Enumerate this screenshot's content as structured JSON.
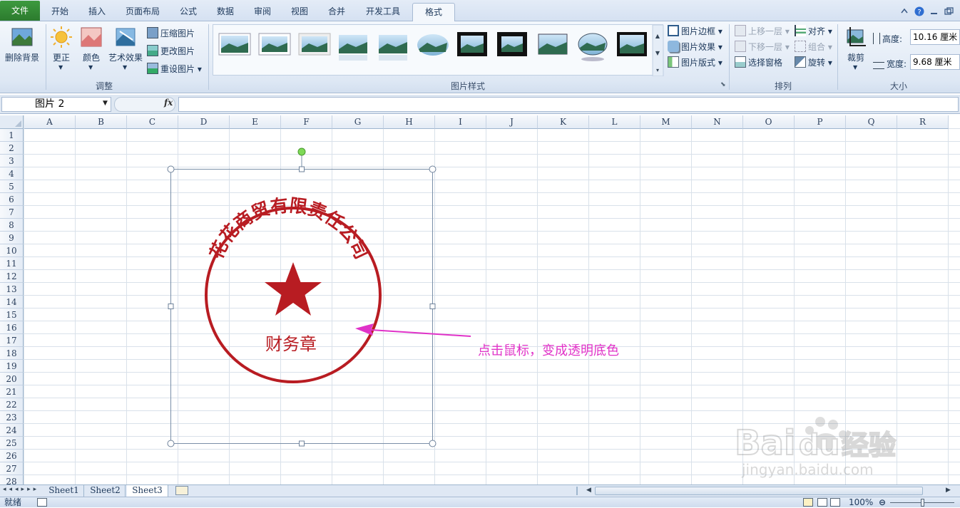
{
  "tabs": [
    {
      "label": "文件"
    },
    {
      "label": "开始"
    },
    {
      "label": "插入"
    },
    {
      "label": "页面布局"
    },
    {
      "label": "公式"
    },
    {
      "label": "数据"
    },
    {
      "label": "审阅"
    },
    {
      "label": "视图"
    },
    {
      "label": "合并"
    },
    {
      "label": "开发工具"
    },
    {
      "label": "格式"
    }
  ],
  "ribbon": {
    "adjust": {
      "remove_bg": "删除背景",
      "corrections": "更正",
      "color": "颜色",
      "artistic": "艺术效果",
      "compress": "压缩图片",
      "change": "更改图片",
      "reset": "重设图片",
      "group_label": "调整"
    },
    "styles": {
      "border": "图片边框",
      "effects": "图片效果",
      "layout": "图片版式",
      "group_label": "图片样式"
    },
    "arrange": {
      "bring_forward": "上移一层",
      "send_backward": "下移一层",
      "selection_pane": "选择窗格",
      "align": "对齐",
      "group": "组合",
      "rotate": "旋转",
      "group_label": "排列"
    },
    "size": {
      "crop": "裁剪",
      "height_label": "高度:",
      "height_value": "10.16 厘米",
      "width_label": "宽度:",
      "width_value": "9.68 厘米",
      "group_label": "大小"
    }
  },
  "formula_bar": {
    "name_box": "图片 2",
    "fx": "fx"
  },
  "columns": [
    "A",
    "B",
    "C",
    "D",
    "E",
    "F",
    "G",
    "H",
    "I",
    "J",
    "K",
    "L",
    "M",
    "N",
    "O",
    "P",
    "Q",
    "R"
  ],
  "rows": [
    "1",
    "2",
    "3",
    "4",
    "5",
    "6",
    "7",
    "8",
    "9",
    "10",
    "11",
    "12",
    "13",
    "14",
    "15",
    "16",
    "17",
    "18",
    "19",
    "20",
    "21",
    "22",
    "23",
    "24",
    "25",
    "26",
    "27",
    "28"
  ],
  "stamp": {
    "company": "花花商贸有限责任公司",
    "label": "财务章",
    "color": "#b81c22"
  },
  "annotation": {
    "text": "点击鼠标，变成透明底色",
    "color": "#e032c8"
  },
  "sheets": [
    "Sheet1",
    "Sheet2",
    "Sheet3"
  ],
  "status": {
    "ready": "就绪",
    "zoom": "100%"
  },
  "watermark": {
    "brand": "Bai du 经验",
    "url": "jingyan.baidu.com"
  }
}
